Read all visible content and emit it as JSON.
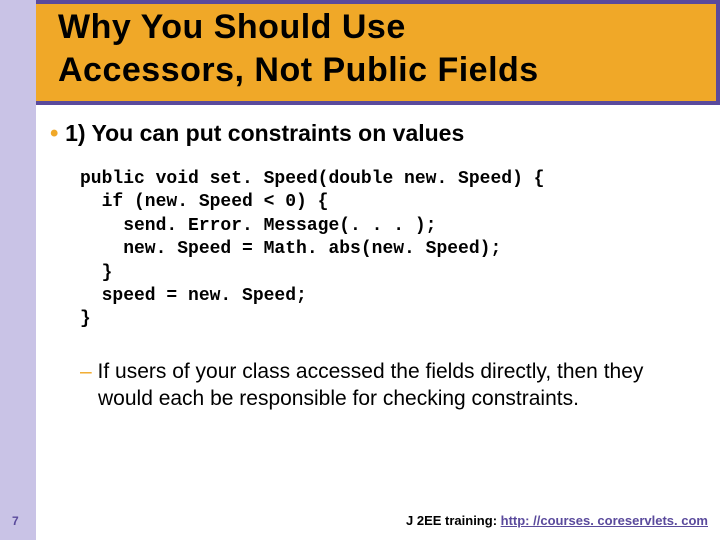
{
  "slide": {
    "title_line1": "Why You Should Use",
    "title_line2": "Accessors, Not Public Fields",
    "bullet1": "1) You can put constraints on values",
    "code": "public void set. Speed(double new. Speed) {\n  if (new. Speed < 0) {\n    send. Error. Message(. . . );\n    new. Speed = Math. abs(new. Speed);\n  }\n  speed = new. Speed;\n}",
    "bullet2": "If users of your class accessed the fields directly, then they would each be responsible for checking constraints.",
    "page_number": "7",
    "footer_prefix": "J 2EE training: ",
    "footer_link": "http: //courses. coreservlets. com"
  }
}
